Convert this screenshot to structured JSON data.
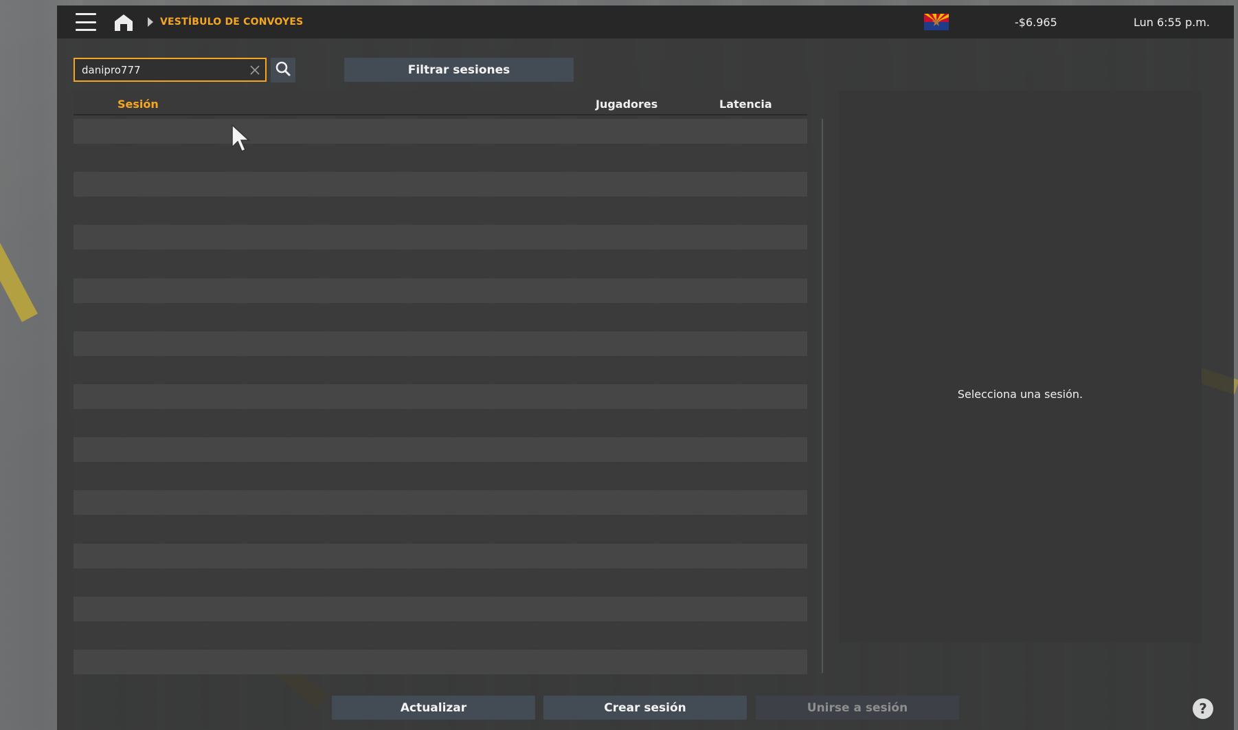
{
  "topbar": {
    "breadcrumb": "VESTÍBULO DE CONVOYES",
    "money": "-$6.965",
    "clock": "Lun 6:55 p.m.",
    "icons": [
      "menu-icon",
      "home-icon",
      "chevron-right-icon",
      "arizona-flag-icon"
    ]
  },
  "search": {
    "value": "danipro777",
    "icons": [
      "close-icon",
      "search-icon"
    ]
  },
  "filter": {
    "label": "Filtrar sesiones"
  },
  "table": {
    "columns": [
      "Sesión",
      "Jugadores",
      "Latencia"
    ],
    "rows": []
  },
  "detail": {
    "empty_text": "Selecciona una sesión."
  },
  "buttons": {
    "refresh": "Actualizar",
    "create": "Crear sesión",
    "join": "Unirse a sesión"
  },
  "help": {
    "label": "?"
  },
  "colors": {
    "accent": "#f5a623",
    "button": "#434b55",
    "panel": "#2d2d2d"
  }
}
